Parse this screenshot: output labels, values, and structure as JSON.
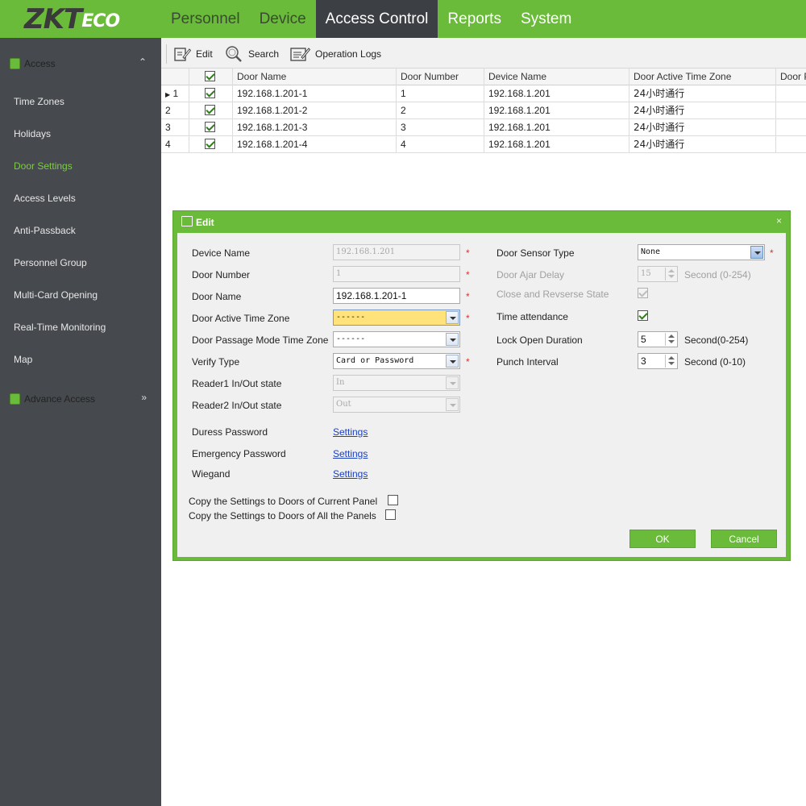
{
  "brand": {
    "logo_main": "ZKT",
    "logo_suffix": "ECO"
  },
  "nav": [
    {
      "label": "Personnel"
    },
    {
      "label": "Device"
    },
    {
      "label": "Access Control"
    },
    {
      "label": "Reports"
    },
    {
      "label": "System"
    }
  ],
  "sidebar": {
    "section1": "Access",
    "items": [
      "Time Zones",
      "Holidays",
      "Door Settings",
      "Access Levels",
      "Anti-Passback",
      "Personnel Group",
      "Multi-Card Opening",
      "Real-Time Monitoring",
      "Map"
    ],
    "active_item": "Door Settings",
    "section2": "Advance Access"
  },
  "toolbar": {
    "edit": "Edit",
    "search": "Search",
    "logs": "Operation Logs"
  },
  "grid": {
    "columns": [
      "Door Name",
      "Door Number",
      "Device Name",
      "Door Active Time Zone",
      "Door P"
    ],
    "rows": [
      {
        "idx": "1",
        "door_name": "192.168.1.201-1",
        "door_number": "1",
        "device_name": "192.168.1.201",
        "time_zone": "24小时通行"
      },
      {
        "idx": "2",
        "door_name": "192.168.1.201-2",
        "door_number": "2",
        "device_name": "192.168.1.201",
        "time_zone": "24小时通行"
      },
      {
        "idx": "3",
        "door_name": "192.168.1.201-3",
        "door_number": "3",
        "device_name": "192.168.1.201",
        "time_zone": "24小时通行"
      },
      {
        "idx": "4",
        "door_name": "192.168.1.201-4",
        "door_number": "4",
        "device_name": "192.168.1.201",
        "time_zone": "24小时通行"
      }
    ]
  },
  "dialog": {
    "title": "Edit",
    "close": "×",
    "left": {
      "device_name_label": "Device Name",
      "device_name_value": "192.168.1.201",
      "door_number_label": "Door Number",
      "door_number_value": "1",
      "door_name_label": "Door Name",
      "door_name_value": "192.168.1.201-1",
      "active_tz_label": "Door Active Time Zone",
      "active_tz_value": "------",
      "passage_tz_label": "Door Passage Mode Time Zone",
      "passage_tz_value": "------",
      "verify_label": "Verify Type",
      "verify_value": "Card or Password",
      "reader1_label": "Reader1 In/Out state",
      "reader1_value": "In",
      "reader2_label": "Reader2 In/Out state",
      "reader2_value": "Out",
      "duress_label": "Duress Password",
      "emergency_label": "Emergency Password",
      "wiegand_label": "Wiegand",
      "settings_link": "Settings"
    },
    "right": {
      "sensor_label": "Door Sensor Type",
      "sensor_value": "None",
      "ajar_label": "Door Ajar Delay",
      "ajar_value": "15",
      "ajar_unit": "Second (0-254)",
      "close_state_label": "Close and Revserse State",
      "time_att_label": "Time attendance",
      "lock_label": "Lock Open Duration",
      "lock_value": "5",
      "lock_unit": "Second(0-254)",
      "punch_label": "Punch Interval",
      "punch_value": "3",
      "punch_unit": "Second (0-10)"
    },
    "copy_current": "Copy the Settings to Doors of Current Panel",
    "copy_all": "Copy the Settings to Doors of All the Panels",
    "ok": "OK",
    "cancel": "Cancel",
    "required_mark": "*"
  },
  "colors": {
    "accent": "#6abb3a",
    "sidebar": "#46494d",
    "active_nav": "#3c3f43",
    "link": "#1a3fbf",
    "required": "#e03030"
  }
}
